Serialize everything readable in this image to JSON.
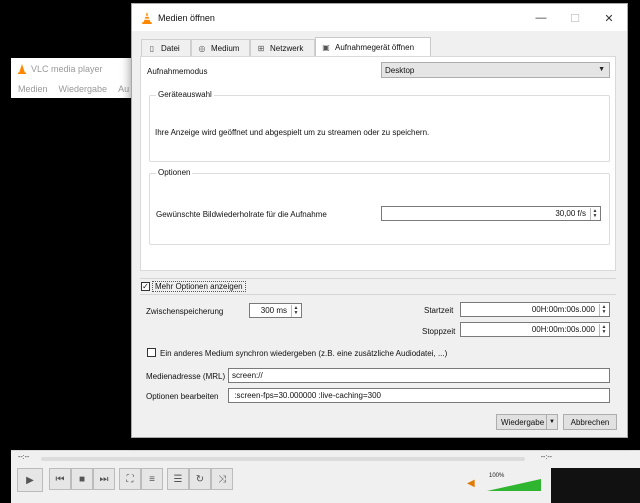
{
  "vlc": {
    "title": "VLC media player",
    "menu": [
      "Medien",
      "Wiedergabe",
      "Au"
    ],
    "time_left": "--:--",
    "time_right": "--:--",
    "volume_percent": "100%",
    "volume_level": 1.0
  },
  "dialog": {
    "title": "Medien öffnen",
    "tabs": [
      {
        "label": "Datei",
        "icon": "file-icon"
      },
      {
        "label": "Medium",
        "icon": "disc-icon"
      },
      {
        "label": "Netzwerk",
        "icon": "network-icon"
      },
      {
        "label": "Aufnahmegerät öffnen",
        "icon": "capture-icon"
      }
    ],
    "capture_mode_label": "Aufnahmemodus",
    "capture_mode_value": "Desktop",
    "device_group_title": "Geräteauswahl",
    "device_text": "Ihre Anzeige wird geöffnet und abgespielt um zu streamen oder zu speichern.",
    "options_group_title": "Optionen",
    "framerate_label": "Gewünschte Bildwiederholrate für die Aufnahme",
    "framerate_value": "30,00 f/s",
    "more_options_label": "Mehr Optionen anzeigen",
    "caching_label": "Zwischenspeicherung",
    "caching_value": "300 ms",
    "start_label": "Startzeit",
    "start_value": "00H:00m:00s.000",
    "stop_label": "Stoppzeit",
    "stop_value": "00H:00m:00s.000",
    "sync_label": "Ein anderes Medium synchron wiedergeben (z.B. eine zusätzliche Audiodatei, ...)",
    "mrl_label": "Medienadresse (MRL)",
    "mrl_value": "screen://",
    "edit_options_label": "Optionen bearbeiten",
    "edit_options_value": " :screen-fps=30.000000 :live-caching=300",
    "play_button": "Wiedergabe",
    "cancel_button": "Abbrechen"
  }
}
